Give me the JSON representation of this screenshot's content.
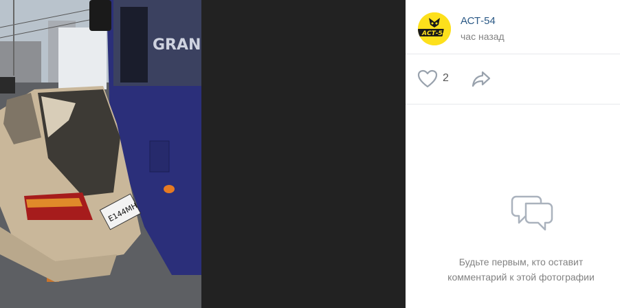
{
  "post": {
    "author": "АСТ-54",
    "time": "час назад",
    "avatar_logo_text": "АСТ-54"
  },
  "actions": {
    "like_icon": "heart-icon",
    "like_count": "2",
    "share_icon": "share-arrow-icon"
  },
  "comments": {
    "empty_icon": "comment-bubbles-icon",
    "empty_text": "Будьте первым, кто оставит комментарий к этой фотографии"
  },
  "photo": {
    "plate_text": "Е144МН"
  },
  "colors": {
    "link": "#2a5885",
    "muted": "#828282",
    "avatar_bg": "#fde01c",
    "bus_blue": "#2b2f7a",
    "car_beige": "#c9b79a",
    "viewer_bg": "#222222"
  }
}
